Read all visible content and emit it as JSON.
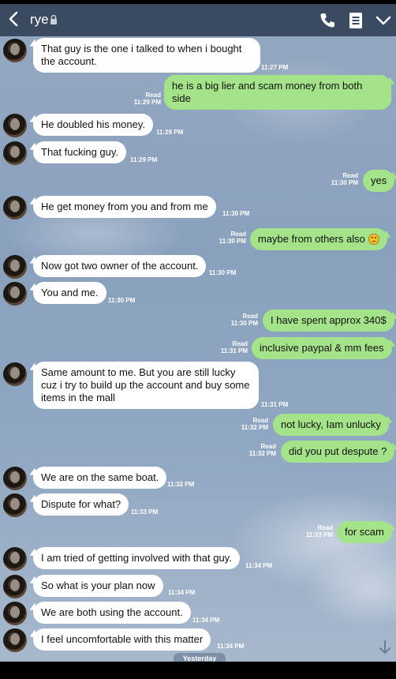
{
  "header": {
    "contact_name": "rye"
  },
  "messages": [
    {
      "side": "in",
      "text": "That guy is the one i talked to when i bought the account.",
      "time": "11:27 PM"
    },
    {
      "side": "out",
      "text": "he is a big lier and scam money from both side",
      "status": "Read",
      "time": "11:29 PM"
    },
    {
      "side": "in",
      "text": "He doubled his money.",
      "time": "11:29 PM"
    },
    {
      "side": "in",
      "text": "That fucking guy.",
      "time": "11:29 PM"
    },
    {
      "side": "out",
      "text": "yes",
      "status": "Read",
      "time": "11:30 PM"
    },
    {
      "side": "in",
      "text": "He get money from you and from me",
      "time": "11:30 PM"
    },
    {
      "side": "out",
      "text": "maybe from others also",
      "status": "Read",
      "time": "11:30 PM",
      "emoji": "sad-face-emoji"
    },
    {
      "side": "in",
      "text": "Now got two owner of the account.",
      "time": "11:30 PM"
    },
    {
      "side": "in",
      "text": "You and me.",
      "time": "11:30 PM"
    },
    {
      "side": "out",
      "text": "I have spent approx 340$",
      "status": "Read",
      "time": "11:30 PM"
    },
    {
      "side": "out",
      "text": "inclusive paypal & mm fees",
      "status": "Read",
      "time": "11:31 PM"
    },
    {
      "side": "in",
      "text": "Same amount to me. But you are still lucky cuz i try to build up the account and buy some items in the mall",
      "time": "11:31 PM"
    },
    {
      "side": "out",
      "text": "not lucky, Iam unlucky",
      "status": "Read",
      "time": "11:32 PM"
    },
    {
      "side": "out",
      "text": "did you put despute ?",
      "status": "Read",
      "time": "11:32 PM"
    },
    {
      "side": "in",
      "text": "We are on the same boat.",
      "time": "11:32 PM"
    },
    {
      "side": "in",
      "text": "Dispute for what?",
      "time": "11:33 PM"
    },
    {
      "side": "out",
      "text": "for scam",
      "status": "Read",
      "time": "11:33 PM"
    },
    {
      "side": "in",
      "text": "I am tried of getting involved with that guy.",
      "time": "11:34 PM"
    },
    {
      "side": "in",
      "text": "So what is your plan now",
      "time": "11:34 PM"
    },
    {
      "side": "in",
      "text": "We are both using the account.",
      "time": "11:34 PM"
    },
    {
      "side": "in",
      "text": "I feel uncomfortable with this matter",
      "time": "11:34 PM"
    }
  ],
  "date_divider": "Yesterday",
  "icons": {
    "back": "back-arrow-icon",
    "lock": "lock-icon",
    "call": "phone-icon",
    "notes": "notes-icon",
    "menu": "chevron-down-icon",
    "scroll": "scroll-down-arrow-icon"
  },
  "colors": {
    "header": "#3a4a60",
    "outgoing_bubble": "#a5e38a",
    "incoming_bubble": "#ffffff"
  }
}
